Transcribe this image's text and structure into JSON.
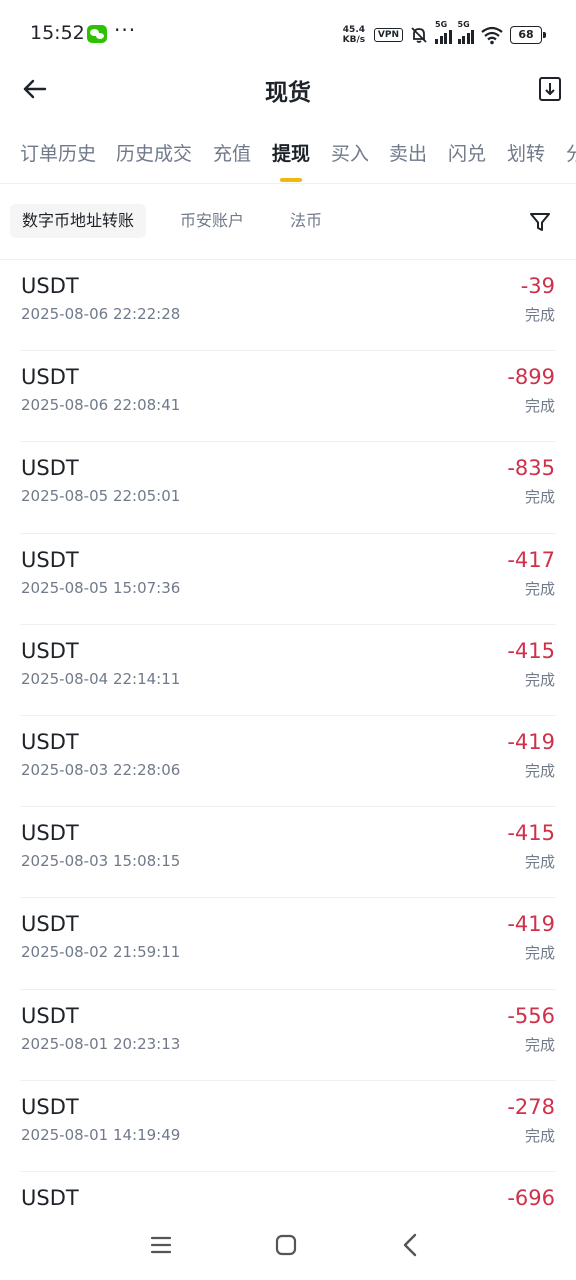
{
  "status_bar": {
    "time": "15:52",
    "net_speed_value": "45.4",
    "net_speed_unit": "KB/s",
    "vpn": "VPN",
    "network_1": "5G",
    "network_2": "5G",
    "battery": "68",
    "icons": [
      "wechat-icon",
      "more-dots-icon",
      "bell-off-icon",
      "signal-icon",
      "wifi-icon",
      "battery-icon"
    ]
  },
  "header": {
    "title": "现货",
    "back_icon": "arrow-left-icon",
    "export_icon": "download-file-icon"
  },
  "tabs": [
    {
      "label": "订单历史"
    },
    {
      "label": "历史成交"
    },
    {
      "label": "充值"
    },
    {
      "label": "提现"
    },
    {
      "label": "买入"
    },
    {
      "label": "卖出"
    },
    {
      "label": "闪兑"
    },
    {
      "label": "划转"
    },
    {
      "label": "分"
    }
  ],
  "active_tab": "提现",
  "subtabs": [
    {
      "label": "数字币地址转账"
    },
    {
      "label": "币安账户"
    },
    {
      "label": "法币"
    }
  ],
  "active_subtab": "数字币地址转账",
  "colors": {
    "accent": "#f0b90b",
    "negative": "#cf304a",
    "text_primary": "#1e2329",
    "text_secondary": "#707a8a"
  },
  "records": [
    {
      "coin": "USDT",
      "time": "2025-08-06 22:22:28",
      "amount": "-39",
      "status": "完成"
    },
    {
      "coin": "USDT",
      "time": "2025-08-06 22:08:41",
      "amount": "-899",
      "status": "完成"
    },
    {
      "coin": "USDT",
      "time": "2025-08-05 22:05:01",
      "amount": "-835",
      "status": "完成"
    },
    {
      "coin": "USDT",
      "time": "2025-08-05 15:07:36",
      "amount": "-417",
      "status": "完成"
    },
    {
      "coin": "USDT",
      "time": "2025-08-04 22:14:11",
      "amount": "-415",
      "status": "完成"
    },
    {
      "coin": "USDT",
      "time": "2025-08-03 22:28:06",
      "amount": "-419",
      "status": "完成"
    },
    {
      "coin": "USDT",
      "time": "2025-08-03 15:08:15",
      "amount": "-415",
      "status": "完成"
    },
    {
      "coin": "USDT",
      "time": "2025-08-02 21:59:11",
      "amount": "-419",
      "status": "完成"
    },
    {
      "coin": "USDT",
      "time": "2025-08-01 20:23:13",
      "amount": "-556",
      "status": "完成"
    },
    {
      "coin": "USDT",
      "time": "2025-08-01 14:19:49",
      "amount": "-278",
      "status": "完成"
    },
    {
      "coin": "USDT",
      "amount": "-696"
    }
  ],
  "nav_bar": {
    "icons": [
      "menu-icon",
      "home-icon",
      "back-icon"
    ]
  }
}
